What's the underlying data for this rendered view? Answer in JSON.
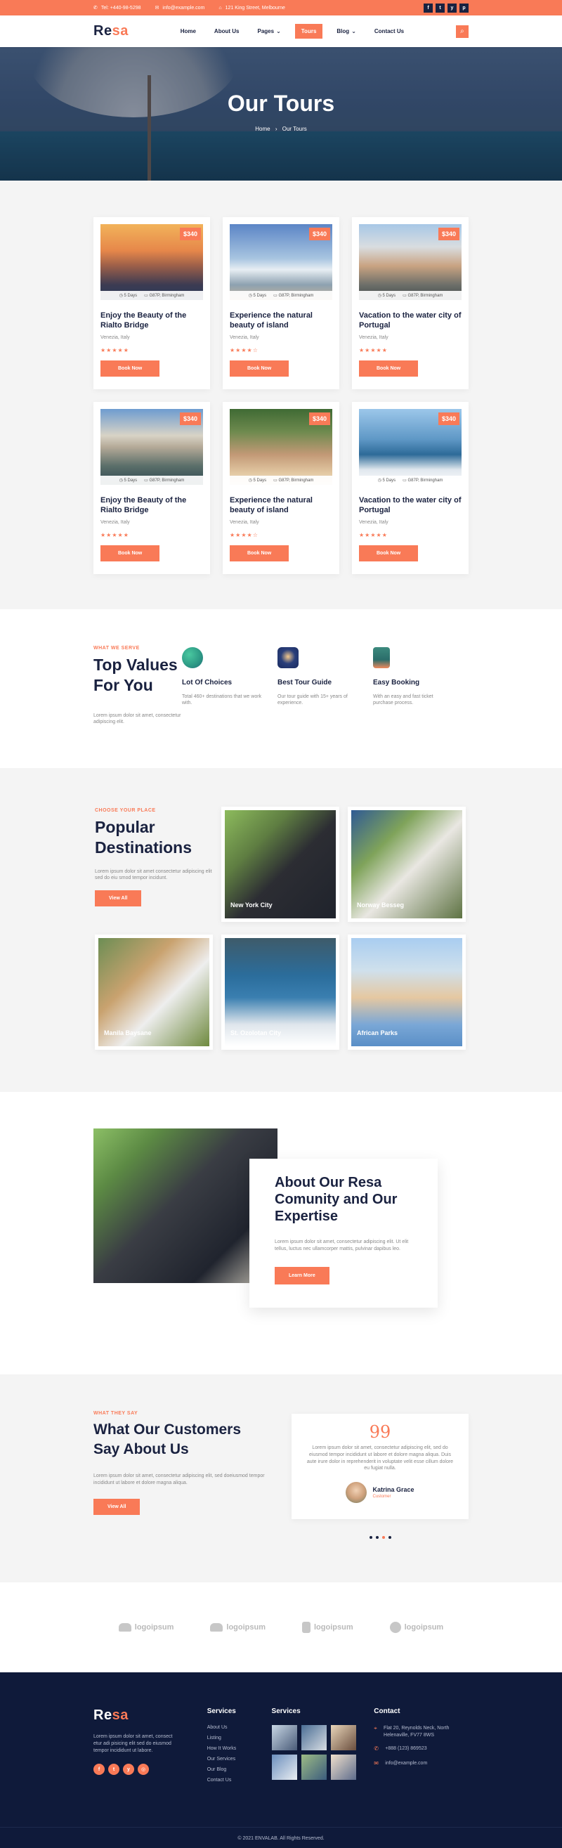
{
  "topbar": {
    "phone": "Tel: +440-98-5298",
    "email": "info@example.com",
    "address": "121 King Street, Melbourne",
    "socials": [
      "f",
      "t",
      "y",
      "p"
    ]
  },
  "header": {
    "logo_a": "Re",
    "logo_b": "sa",
    "nav": [
      "Home",
      "About Us",
      "Pages",
      "Tours",
      "Blog",
      "Contact Us"
    ],
    "nav_active": "Tours"
  },
  "hero": {
    "title": "Our Tours",
    "crumb_home": "Home",
    "crumb_sep": "›",
    "crumb_current": "Our Tours"
  },
  "tours": [
    {
      "price": "$340",
      "days": "5 Days",
      "place": "G87P, Birmingham",
      "title": "Enjoy the Beauty of the Rialto Bridge",
      "loc": "Venezia, Italy",
      "btn": "Book Now"
    },
    {
      "price": "$340",
      "days": "5 Days",
      "place": "G87P, Birmingham",
      "title": "Experience the natural beauty of island",
      "loc": "Venezia, Italy",
      "btn": "Book Now"
    },
    {
      "price": "$340",
      "days": "5 Days",
      "place": "G87P, Birmingham",
      "title": "Vacation to the water city of Portugal",
      "loc": "Venezia, Italy",
      "btn": "Book Now"
    },
    {
      "price": "$340",
      "days": "5 Days",
      "place": "G87P, Birmingham",
      "title": "Enjoy the Beauty of the Rialto Bridge",
      "loc": "Venezia, Italy",
      "btn": "Book Now"
    },
    {
      "price": "$340",
      "days": "5 Days",
      "place": "G87P, Birmingham",
      "title": "Experience the natural beauty of island",
      "loc": "Venezia, Italy",
      "btn": "Book Now"
    },
    {
      "price": "$340",
      "days": "5 Days",
      "place": "G87P, Birmingham",
      "title": "Vacation to the water city of Portugal",
      "loc": "Venezia, Italy",
      "btn": "Book Now"
    }
  ],
  "values": {
    "eyebrow": "WHAT WE SERVE",
    "title": "Top Values For You",
    "text": "Lorem ipsum dolor sit amet, consectetur adipiscing elit.",
    "items": [
      {
        "title": "Lot Of Choices",
        "text": "Total 460+ destinations that we work with."
      },
      {
        "title": "Best Tour Guide",
        "text": "Our tour guide with 15+ years of experience."
      },
      {
        "title": "Easy Booking",
        "text": "With an easy and fast ticket purchase process."
      }
    ]
  },
  "destinations": {
    "eyebrow": "CHOOSE YOUR PLACE",
    "title": "Popular Destinations",
    "text": "Lorem ipsum dolor sit amet consectetur adipiscing elit sed do eiu smod tempor incidunt.",
    "btn": "View All",
    "items": [
      "New York City",
      "Norway Besseg",
      "Manila Baysane",
      "St. Ozolotan City",
      "African Parks"
    ]
  },
  "about": {
    "title": "About Our Resa Comunity and Our Expertise",
    "text": "Lorem ipsum dolor sit amet, consectetur adipiscing elit. Ut elit tellus, luctus nec ullamcorper mattis, pulvinar dapibus leo.",
    "btn": "Learn More"
  },
  "testimonials": {
    "eyebrow": "WHAT THEY SAY",
    "title": "What Our Customers Say About Us",
    "text": "Lorem ipsum dolor sit amet, consectetur adipiscing elit, sed doeiusmod tempor incididunt ut labore et dolore magna aliqua.",
    "btn": "View All",
    "quote": "Lorem ipsum dolor sit amet, consectetur adipiscing elit, sed do eiusmod tempor incididunt ut labore et dolore magna aliqua. Duis aute irure dolor in reprehenderit in voluptate velit esse cillum dolore eu fugiat nulla.",
    "author": "Katrina Grace",
    "role": "Customer",
    "qmark": "99"
  },
  "logos": [
    "logoipsum",
    "logoipsum",
    "logoipsum",
    "logoipsum"
  ],
  "footer": {
    "about": "Lorem ipsum dolor sit amet, consect etur adi pisicing elit sed do eiusmod tempor incididunt ut labore.",
    "services_title": "Services",
    "services": [
      "About Us",
      "Listing",
      "How It Works",
      "Our Services",
      "Our Blog",
      "Contact Us"
    ],
    "gallery_title": "Services",
    "contact_title": "Contact",
    "address": "Flat 20, Reynolds Neck, North Helenaville, FV77 8WS",
    "phone": "+888 (123) 869523",
    "email": "info@example.com",
    "copyright": "© 2021 ENVALAB. All Rights Reserved."
  },
  "colors": {
    "accent": "#f97a57",
    "navy": "#1a2240",
    "footer": "#0f1a3a",
    "muted": "#888888",
    "light_bg": "#f4f4f4"
  }
}
